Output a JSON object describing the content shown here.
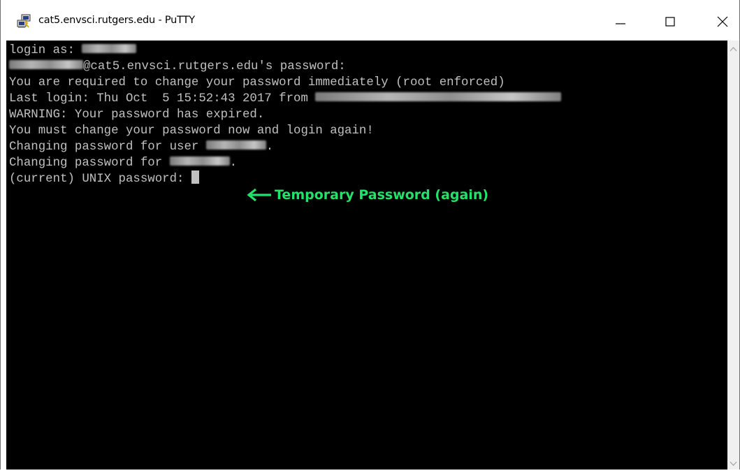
{
  "window": {
    "title": "cat5.envsci.rutgers.edu - PuTTY",
    "icon": "putty-icon",
    "controls": [
      "minimize-icon",
      "maximize-icon",
      "close-icon"
    ]
  },
  "terminal": {
    "colors": {
      "background": "#000000",
      "foreground": "#c0c0c0",
      "annotation": "#21e36b"
    },
    "lines": [
      {
        "prefix": "login as: ",
        "suffix": ""
      },
      {
        "prefix": "",
        "suffix": "@cat5.envsci.rutgers.edu's password:"
      },
      {
        "prefix": "You are required to change your password immediately (root enforced)",
        "suffix": ""
      },
      {
        "prefix": "Last login: Thu Oct  5 15:52:43 2017 from ",
        "suffix": ""
      },
      {
        "prefix": "WARNING: Your password has expired.",
        "suffix": ""
      },
      {
        "prefix": "You must change your password now and login again!",
        "suffix": ""
      },
      {
        "prefix": "Changing password for user ",
        "suffix": "."
      },
      {
        "prefix": "Changing password for ",
        "suffix": "."
      },
      {
        "prefix": "(current) UNIX password: ",
        "suffix": ""
      }
    ],
    "annotation": {
      "icon": "left-arrow-icon",
      "text": "Temporary Password (again)"
    }
  }
}
